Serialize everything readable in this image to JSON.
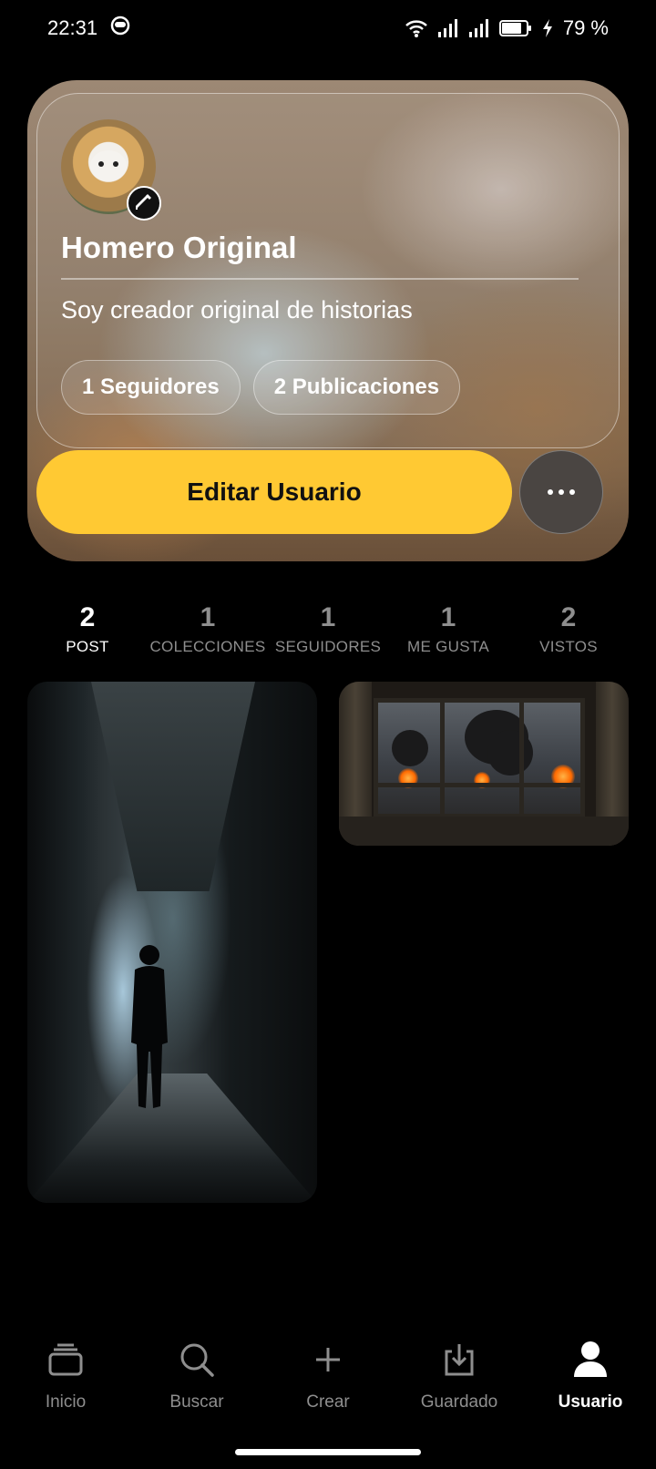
{
  "status_bar": {
    "time": "22:31",
    "battery_percent": "79 %"
  },
  "profile": {
    "name": "Homero Original",
    "bio": "Soy creador original de historias",
    "chips": [
      "1 Seguidores",
      "2 Publicaciones"
    ],
    "edit_button_label": "Editar Usuario"
  },
  "stats": [
    {
      "number": "2",
      "label": "POST",
      "active": true
    },
    {
      "number": "1",
      "label": "COLECCIONES",
      "active": false
    },
    {
      "number": "1",
      "label": "SEGUIDORES",
      "active": false
    },
    {
      "number": "1",
      "label": "ME GUSTA",
      "active": false
    },
    {
      "number": "2",
      "label": "VISTOS",
      "active": false
    }
  ],
  "nav": [
    {
      "label": "Inicio",
      "icon": "stack-icon"
    },
    {
      "label": "Buscar",
      "icon": "search-icon"
    },
    {
      "label": "Crear",
      "icon": "plus-icon"
    },
    {
      "label": "Guardado",
      "icon": "download-tray-icon"
    },
    {
      "label": "Usuario",
      "icon": "user-icon",
      "active": true
    }
  ],
  "colors": {
    "accent": "#ffc933",
    "background": "#000000",
    "inactive": "#8e8e8e"
  }
}
